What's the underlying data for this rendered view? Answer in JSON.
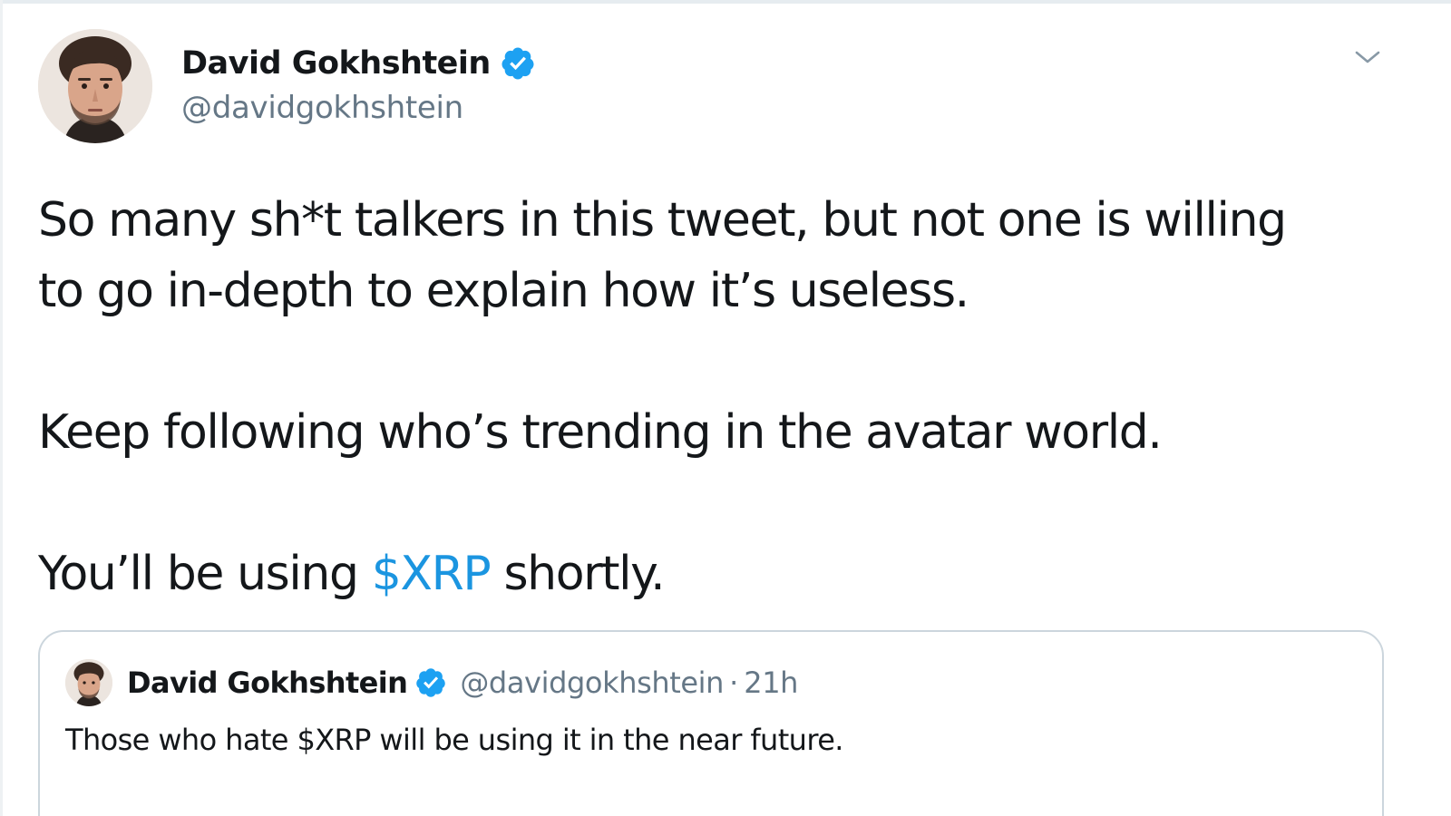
{
  "tweet": {
    "author": {
      "display_name": "David Gokhshtein",
      "handle": "@davidgokhshtein",
      "verified": true,
      "avatar_icon": "avatar-photo"
    },
    "menu_icon": "chevron-down-icon",
    "text": {
      "line1": "So many sh*t talkers in this tweet, but not one is willing",
      "line2": "to go in-depth to explain how it’s useless.",
      "line3": "Keep following who’s trending in the avatar world.",
      "line4_before": "You’ll be using ",
      "line4_cashtag": "$XRP",
      "line4_after": " shortly."
    }
  },
  "quoted_tweet": {
    "author": {
      "display_name": "David Gokhshtein",
      "handle": "@davidgokhshtein",
      "verified": true
    },
    "separator": "·",
    "time": "21h",
    "text": "Those who hate $XRP will be using it in the near future."
  },
  "colors": {
    "link": "#1b95e0",
    "secondary_text": "#657786",
    "verified_badge": "#1da1f2",
    "border": "#ccd6dd"
  }
}
